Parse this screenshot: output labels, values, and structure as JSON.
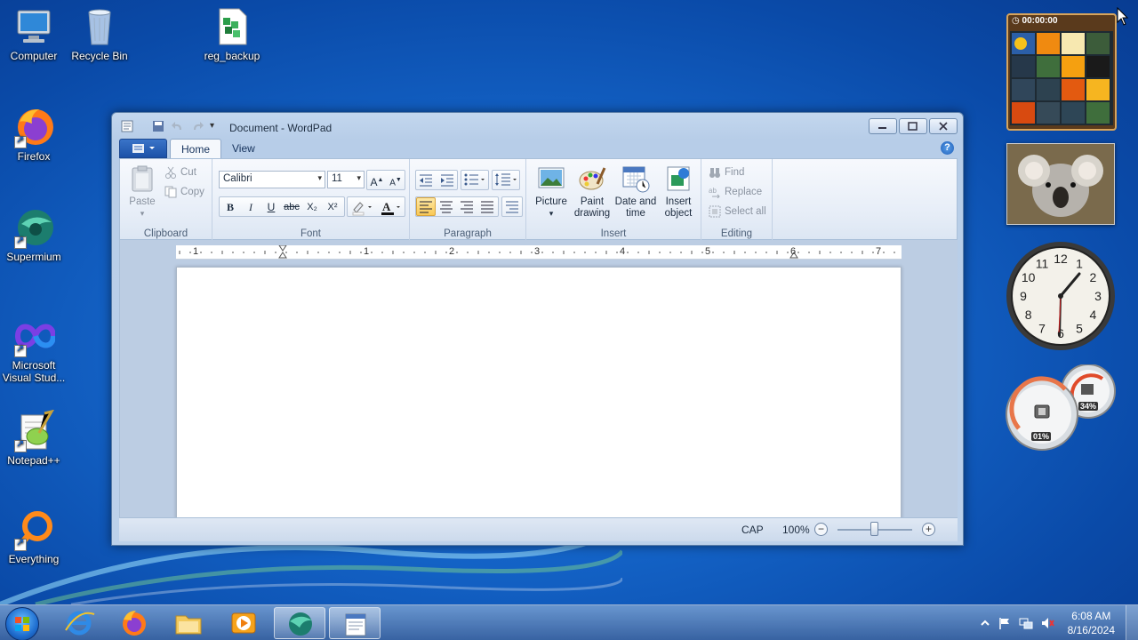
{
  "desktop": {
    "icons": [
      {
        "label": "Computer",
        "icon": "computer-icon"
      },
      {
        "label": "Recycle Bin",
        "icon": "recycle-bin-icon"
      },
      {
        "label": "reg_backup",
        "icon": "registry-file-icon"
      },
      {
        "label": "Firefox",
        "icon": "firefox-icon"
      },
      {
        "label": "Supermium",
        "icon": "supermium-icon"
      },
      {
        "label": "Microsoft Visual Stud...",
        "icon": "visual-studio-icon"
      },
      {
        "label": "Notepad++",
        "icon": "notepadpp-icon"
      },
      {
        "label": "Everything",
        "icon": "everything-search-icon"
      }
    ]
  },
  "window": {
    "title": "Document - WordPad",
    "tabs": [
      {
        "label": "Home",
        "active": true
      },
      {
        "label": "View",
        "active": false
      }
    ],
    "ribbon": {
      "clipboard": {
        "label": "Clipboard",
        "paste": "Paste",
        "cut": "Cut",
        "copy": "Copy"
      },
      "font": {
        "label": "Font",
        "family": "Calibri",
        "size": "11",
        "buttons": [
          "B",
          "I",
          "U",
          "abc",
          "X₂",
          "X²"
        ]
      },
      "paragraph": {
        "label": "Paragraph"
      },
      "insert": {
        "label": "Insert",
        "picture": "Picture",
        "paint_drawing": "Paint drawing",
        "date_time": "Date and time",
        "insert_object": "Insert object"
      },
      "editing": {
        "label": "Editing",
        "find": "Find",
        "replace": "Replace",
        "select_all": "Select all"
      }
    },
    "ruler": {
      "numbers": [
        "1",
        "1",
        "2",
        "3",
        "4",
        "5",
        "6",
        "7"
      ]
    },
    "status": {
      "cap": "CAP",
      "zoom": "100%",
      "zoom_out": "−",
      "zoom_in": "+"
    }
  },
  "gadgets": {
    "puzzle_timer": "00:00:00",
    "clock_numbers": [
      "12",
      "1",
      "2",
      "3",
      "4",
      "5",
      "6",
      "7",
      "8",
      "9",
      "10",
      "11"
    ],
    "cpu_percent": "01%",
    "memory_percent": "34%"
  },
  "taskbar": {
    "time": "6:08 AM",
    "date": "8/16/2024",
    "items": [
      "internet-explorer-icon",
      "firefox-icon",
      "file-explorer-icon",
      "media-player-icon",
      "supermium-icon",
      "wordpad-icon"
    ]
  }
}
